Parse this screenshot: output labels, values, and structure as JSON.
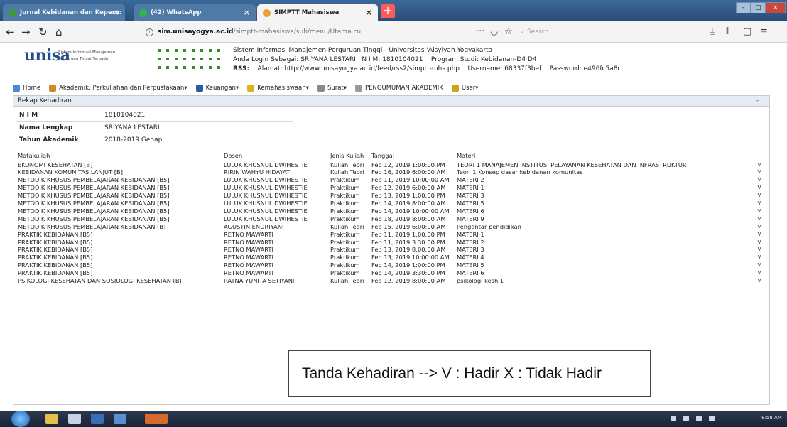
{
  "browser": {
    "tabs": [
      {
        "label": "Jurnal Kebidanan dan Kepera:",
        "icon_color": "#3b9a3b"
      },
      {
        "label": "(42) WhatsApp",
        "icon_color": "#2fb54a"
      },
      {
        "label": "SIMPTT Mahasiswa",
        "icon_color": "#e8a33a"
      }
    ],
    "new_tab_icon": "+",
    "url_host": "sim.unisayogya.ac.id",
    "url_path": "/simptt-mahasiswa/sub/menu/Utama.cul",
    "search_placeholder": "Search",
    "nav_icons": [
      "back-icon",
      "forward-icon",
      "reload-icon",
      "home-icon"
    ]
  },
  "site": {
    "logo": "unisa",
    "tagline_line1": "Sistem Informasi Manajemen",
    "tagline_line2": "Perguruan Tinggi Terpadu",
    "system_title": "Sistem Informasi Manajemen Perguruan Tinggi - Universitas 'Aisyiyah Yogyakarta",
    "login_label": "Anda Login Sebagai:",
    "login_name": "SRIYANA LESTARI",
    "nim_label": "N I M:",
    "nim_value": "1810104021",
    "program_label": "Program Studi:",
    "program_value": "Kebidanan-D4 D4",
    "rss_label": "RSS:",
    "rss_url_label": "Alamat:",
    "rss_url": "http://www.unisayogya.ac.id/feed/rss2/simptt-mhs.php",
    "username_label": "Username:",
    "username_value": "68337f3bef",
    "password_label": "Password:",
    "password_value": "e496fc5a8c"
  },
  "menu": [
    {
      "label": "Home",
      "color": "#4a8ad4"
    },
    {
      "label": "Akademik, Perkuliahan dan Perpustakaan",
      "color": "#d08a2a"
    },
    {
      "label": "Keuangan",
      "color": "#2a5aa8"
    },
    {
      "label": "Kemahasiswaan",
      "color": "#e0b020"
    },
    {
      "label": "Surat",
      "color": "#8a8a8a"
    },
    {
      "label": "PENGUMUMAN AKADEMIK",
      "color": "#9a9a9a"
    },
    {
      "label": "User",
      "color": "#d4a020"
    }
  ],
  "panel": {
    "title": "Rekap Kehadiran",
    "info": [
      {
        "key": "N I M",
        "value": "1810104021"
      },
      {
        "key": "Nama Lengkap",
        "value": "SRIYANA LESTARI"
      },
      {
        "key": "Tahun Akademik",
        "value": "2018-2019 Genap"
      }
    ],
    "columns": [
      "Matakuliah",
      "Dosen",
      "Jenis Kuliah",
      "Tanggal",
      "Materi"
    ],
    "rows": [
      [
        "EKONOMI KESEHATAN [B]",
        "LULUK KHUSNUL DWIHESTIE",
        "Kuliah Teori",
        "Feb 12, 2019 1:00:00 PM",
        "TEORI 1 MANAJEMEN INSTITUSI PELAYANAN KESEHATAN DAN INFRASTRUKTUR",
        "V"
      ],
      [
        "KEBIDANAN KOMUNITAS LANJUT [B]",
        "RIRIN WAHYU HIDAYATI",
        "Kuliah Teori",
        "Feb 16, 2019 6:00:00 AM",
        "Teori 1 Konsep dasar kebidanan komunitas",
        "V"
      ],
      [
        "METODIK KHUSUS PEMBELAJARAN KEBIDANAN [B5]",
        "LULUK KHUSNUL DWIHESTIE",
        "Praktikum",
        "Feb 11, 2019 10:00:00 AM",
        "MATERI 2",
        "V"
      ],
      [
        "METODIK KHUSUS PEMBELAJARAN KEBIDANAN [B5]",
        "LULUK KHUSNUL DWIHESTIE",
        "Praktikum",
        "Feb 12, 2019 6:00:00 AM",
        "MATERI 1",
        "V"
      ],
      [
        "METODIK KHUSUS PEMBELAJARAN KEBIDANAN [B5]",
        "LULUK KHUSNUL DWIHESTIE",
        "Praktikum",
        "Feb 13, 2019 1:00:00 PM",
        "MATERI 3",
        "V"
      ],
      [
        "METODIK KHUSUS PEMBELAJARAN KEBIDANAN [B5]",
        "LULUK KHUSNUL DWIHESTIE",
        "Praktikum",
        "Feb 14, 2019 8:00:00 AM",
        "MATERI 5",
        "V"
      ],
      [
        "METODIK KHUSUS PEMBELAJARAN KEBIDANAN [B5]",
        "LULUK KHUSNUL DWIHESTIE",
        "Praktikum",
        "Feb 14, 2019 10:00:00 AM",
        "MATERI 6",
        "V"
      ],
      [
        "METODIK KHUSUS PEMBELAJARAN KEBIDANAN [B5]",
        "LULUK KHUSNUL DWIHESTIE",
        "Praktikum",
        "Feb 18, 2019 8:00:00 AM",
        "MATERI 9",
        "V"
      ],
      [
        "METODIK KHUSUS PEMBELAJARAN KEBIDANAN [B]",
        "AGUSTIN ENDRIYANI",
        "Kuliah Teori",
        "Feb 15, 2019 6:00:00 AM",
        "Pengantar pendidikan",
        "V"
      ],
      [
        "PRAKTIK KEBIDANAN [B5]",
        "RETNO MAWARTI",
        "Praktikum",
        "Feb 11, 2019 1:00:00 PM",
        "MATERI 1",
        "V"
      ],
      [
        "PRAKTIK KEBIDANAN [B5]",
        "RETNO MAWARTI",
        "Praktikum",
        "Feb 11, 2019 3:30:00 PM",
        "MATERI 2",
        "V"
      ],
      [
        "PRAKTIK KEBIDANAN [B5]",
        "RETNO MAWARTI",
        "Praktikum",
        "Feb 13, 2019 8:00:00 AM",
        "MATERI 3",
        "V"
      ],
      [
        "PRAKTIK KEBIDANAN [B5]",
        "RETNO MAWARTI",
        "Praktikum",
        "Feb 13, 2019 10:00:00 AM",
        "MATERI 4",
        "V"
      ],
      [
        "PRAKTIK KEBIDANAN [B5]",
        "RETNO MAWARTI",
        "Praktikum",
        "Feb 14, 2019 1:00:00 PM",
        "MATERI 5",
        "V"
      ],
      [
        "PRAKTIK KEBIDANAN [B5]",
        "RETNO MAWARTI",
        "Praktikum",
        "Feb 14, 2019 3:30:00 PM",
        "MATERI 6",
        "V"
      ],
      [
        "PSIKOLOGI KESEHATAN DAN SOSIOLOGI KESEHATAN [B]",
        "RATNA YUNITA SETIYANI",
        "Kuliah Teori",
        "Feb 12, 2019 8:00:00 AM",
        "psikologi kesh 1",
        "V"
      ]
    ]
  },
  "note": "Tanda Kehadiran --> V : Hadir     X : Tidak Hadir",
  "taskbar": {
    "clock": "8:58 AM"
  }
}
